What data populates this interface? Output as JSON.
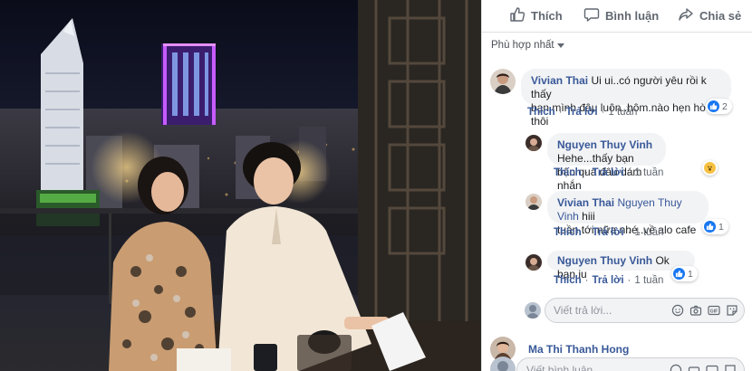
{
  "actions": {
    "like": "Thích",
    "comment": "Bình luận",
    "share": "Chia sẻ"
  },
  "sort": {
    "label": "Phù hợp nhất"
  },
  "comments": [
    {
      "author": "Vivian Thai",
      "text_line1": "Ui ui..có người yêu rồi k thấy",
      "text_line2": "bạn mình đâu luôn..hôm.nào hẹn hò thôi",
      "reaction_count": "2",
      "reaction_icon": "like-icon",
      "like_label": "Thích",
      "reply_label": "Trả lời",
      "time": "1 tuần"
    },
    {
      "author": "Nguyen Thuy Vinh",
      "text_line1": "Hehe...thấy bạn",
      "text_line2": "bận quá đâu dám nhắn",
      "reaction_icon": "wow-icon",
      "like_label": "Thích",
      "reply_label": "Trả lời",
      "time": "1 tuần"
    },
    {
      "author": "Vivian Thai",
      "mention": "Nguyen Thuy Vinh",
      "text_line1": "hiii",
      "text_line2": "tuần tới nữa nhé..về alo cafe",
      "reaction_count": "1",
      "reaction_icon": "like-icon",
      "like_label": "Thích",
      "reply_label": "Trả lời",
      "time": "1 tuần"
    },
    {
      "author": "Nguyen Thuy Vinh",
      "text_line1": "Ok bạn iu",
      "reaction_count": "1",
      "reaction_icon": "like-icon",
      "like_label": "Thích",
      "reply_label": "Trả lời",
      "time": "1 tuần"
    }
  ],
  "reply_input": {
    "placeholder": "Viết trả lời..."
  },
  "next_comment_author": "Ma Thi Thanh Hong",
  "comment_input": {
    "placeholder": "Viết bình luận..."
  },
  "colors": {
    "link": "#385898",
    "like_blue": "#1877f2",
    "bubble": "#f2f3f5",
    "wow": "#f7c143"
  }
}
